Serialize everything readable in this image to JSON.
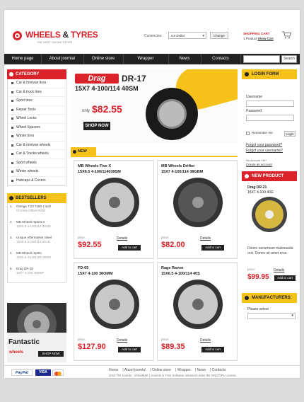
{
  "logo": {
    "name_part1": "WHEELS",
    "amp": " & ",
    "name_part2": "TYRES",
    "tagline": "THE BEST ONLINE STORE"
  },
  "currency": {
    "label": "Currencies:",
    "selected": "US Dollar",
    "change_label": "Change"
  },
  "cart": {
    "title": "SHOPPING CART",
    "items": "1 Product",
    "show_label": "Show Cart"
  },
  "nav": {
    "items": [
      "Home page",
      "About joomla!",
      "Online store",
      "Wrapper",
      "News",
      "Contacts"
    ],
    "search_button": "Search"
  },
  "category": {
    "title": "CATEGORY",
    "items": [
      "Car & minivan tires",
      "Car & truck tires",
      "Sport tires",
      "Repair Tools",
      "Wheel Locks",
      "Wheel Spacers",
      "Winter tires",
      "Car & minivan wheels",
      "Car & Trucks wheels",
      "Sport wheels",
      "Winter wheels",
      "Hubcaps & Covers"
    ]
  },
  "bestsellers": {
    "title": "BESTSELLERS",
    "items": [
      {
        "num": "1.",
        "name": "Omega 7.23 7290 1 inch",
        "sub": "Chrome Offset RWD"
      },
      {
        "num": "2.",
        "name": "MB Wheels Sprint X",
        "sub": "15X6.5 4-100/114 38SM"
      },
      {
        "num": "3.",
        "name": "Unique Aftermarket Steel",
        "sub": "15X6.5 4-100/114 4S1D"
      },
      {
        "num": "4.",
        "name": "MB Wheels Sprits",
        "sub": "15X6.5 4-100/108 38SM"
      },
      {
        "num": "5.",
        "name": "Drag DR-30",
        "sub": "15X7 4-100 40DMF"
      }
    ]
  },
  "promo": {
    "title": "Fantastic",
    "subtitle": "wheels",
    "button": "SHOP NOW"
  },
  "banner": {
    "brand": "Drag",
    "model": "DR-17",
    "spec": "15X7 4-100/114 40SM",
    "only_label": "only",
    "price": "$82.55",
    "button": "SHOP NOW"
  },
  "new_section": {
    "title": "NEW"
  },
  "products": [
    {
      "name": "MB Wheels Five X",
      "spec": "15X6.5 4-100/114038SM",
      "price_label": "price:",
      "price": "$92.55",
      "details": "Details",
      "add": "Add to cart"
    },
    {
      "name": "MB Wheels Drifter",
      "spec": "15X7 4-100/114 38GBM",
      "price_label": "price:",
      "price": "$82.00",
      "details": "Details",
      "add": "Add to cart"
    },
    {
      "name": "FD-05",
      "spec": "15X7 4-100 38OMM",
      "price_label": "price:",
      "price": "$127.90",
      "details": "Details",
      "add": "Add to cart"
    },
    {
      "name": "Rage Raven",
      "spec": "15X6.5 4-100/114 40S",
      "price_label": "price:",
      "price": "$89.35",
      "details": "Details",
      "add": "Add to cart"
    }
  ],
  "login": {
    "title": "LOGIN FORM",
    "username_label": "Username",
    "password_label": "Password",
    "remember_label": "Remember me",
    "login_button": "Login",
    "forgot_password": "Forgot your password?",
    "forgot_username": "Forgot your username?",
    "no_account": "No account Yet?",
    "create_account": "Create an account"
  },
  "new_product": {
    "title": "NEW PRODUCT",
    "name": "Drag DR-21",
    "spec": "15X7 4-100 40G",
    "description": "Donec accumsan malesuada orci. Donec sit amet eros.",
    "price_label": "price:",
    "price": "$99.95",
    "details": "Details",
    "add": "Add to cart"
  },
  "manufacturers": {
    "title": "MANUFACTURERS:",
    "select_label": "Please select"
  },
  "footer": {
    "payments": {
      "paypal": "PayPal",
      "visa": "VISA"
    },
    "links": [
      "Home",
      "About joomla!",
      "Online store",
      "Wrapper",
      "News",
      "Contacts"
    ],
    "copyright": "2013  TM Joomla - VirtueMart  |  Joomla! is Free Software released under the GNU/GPL License."
  },
  "colors": {
    "accent_red": "#d9222a",
    "accent_yellow": "#f5c21c",
    "nav_bg": "#222222"
  }
}
